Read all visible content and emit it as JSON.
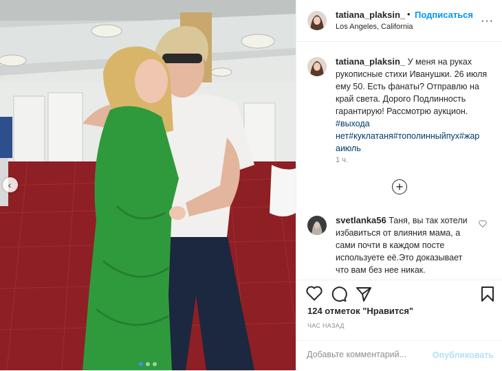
{
  "post": {
    "author": "tatiana_plaksin_",
    "separator": "•",
    "follow_label": "Подписаться",
    "location": "Los Angeles, California",
    "more_label": "···"
  },
  "caption": {
    "username": "tatiana_plaksin_",
    "text": "У меня на руках рукописные стихи Иванушки. 26 июля ему 50. Есть фанаты? Отправлю на край света. Дорого Подлинность гарантирую! Рассмотрю аукцион. ",
    "hashtags": "#выхода нет#куклатаня#тополинныйпух#жар аиюль",
    "time": "1 ч."
  },
  "load_more_label": "+",
  "comment": {
    "username": "svetlanka56",
    "text": "Таня, вы так хотели избавиться от влияния мама, а сами почти в каждом посте используете её.Это доказывает что вам без нее никак."
  },
  "likes_text": "124 отметок \"Нравится\"",
  "time_ago": "ЧАС НАЗАД",
  "add_comment": {
    "placeholder": "Добавьте комментарий...",
    "publish_label": "Опубликовать"
  },
  "carousel": {
    "slide_count": 3,
    "active_index": 0
  },
  "colors": {
    "accent": "#0095f6",
    "publish_disabled": "#b2dffc",
    "dress_green": "#2f9a3b",
    "carpet_red": "#8e1f24"
  }
}
